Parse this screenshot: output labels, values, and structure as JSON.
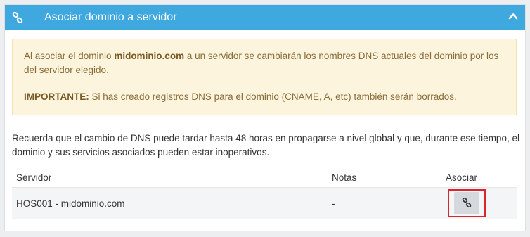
{
  "panel": {
    "title": "Asociar dominio a servidor",
    "header_icon": "link-icon",
    "collapse_icon": "chevron-up-icon",
    "accent_color": "#3fa9df"
  },
  "alert": {
    "line1_pre": "Al asociar el dominio ",
    "line1_domain": "midominio.com",
    "line1_post": " a un servidor se cambiarán los nombres DNS actuales del dominio por los del servidor elegido.",
    "important_label": "IMPORTANTE:",
    "important_text": " Si has creado registros DNS para el dominio (CNAME, A, etc) también serán borrados."
  },
  "notice": "Recuerda que el cambio de DNS puede tardar hasta 48 horas en propagarse a nivel global y que, durante ese tiempo, el dominio y sus servicios asociados pueden estar inoperativos.",
  "table": {
    "headers": [
      "Servidor",
      "Notas",
      "Asociar"
    ],
    "rows": [
      {
        "server": "HOS001 - midominio.com",
        "notes": "-",
        "action_icon": "link-icon"
      }
    ]
  }
}
